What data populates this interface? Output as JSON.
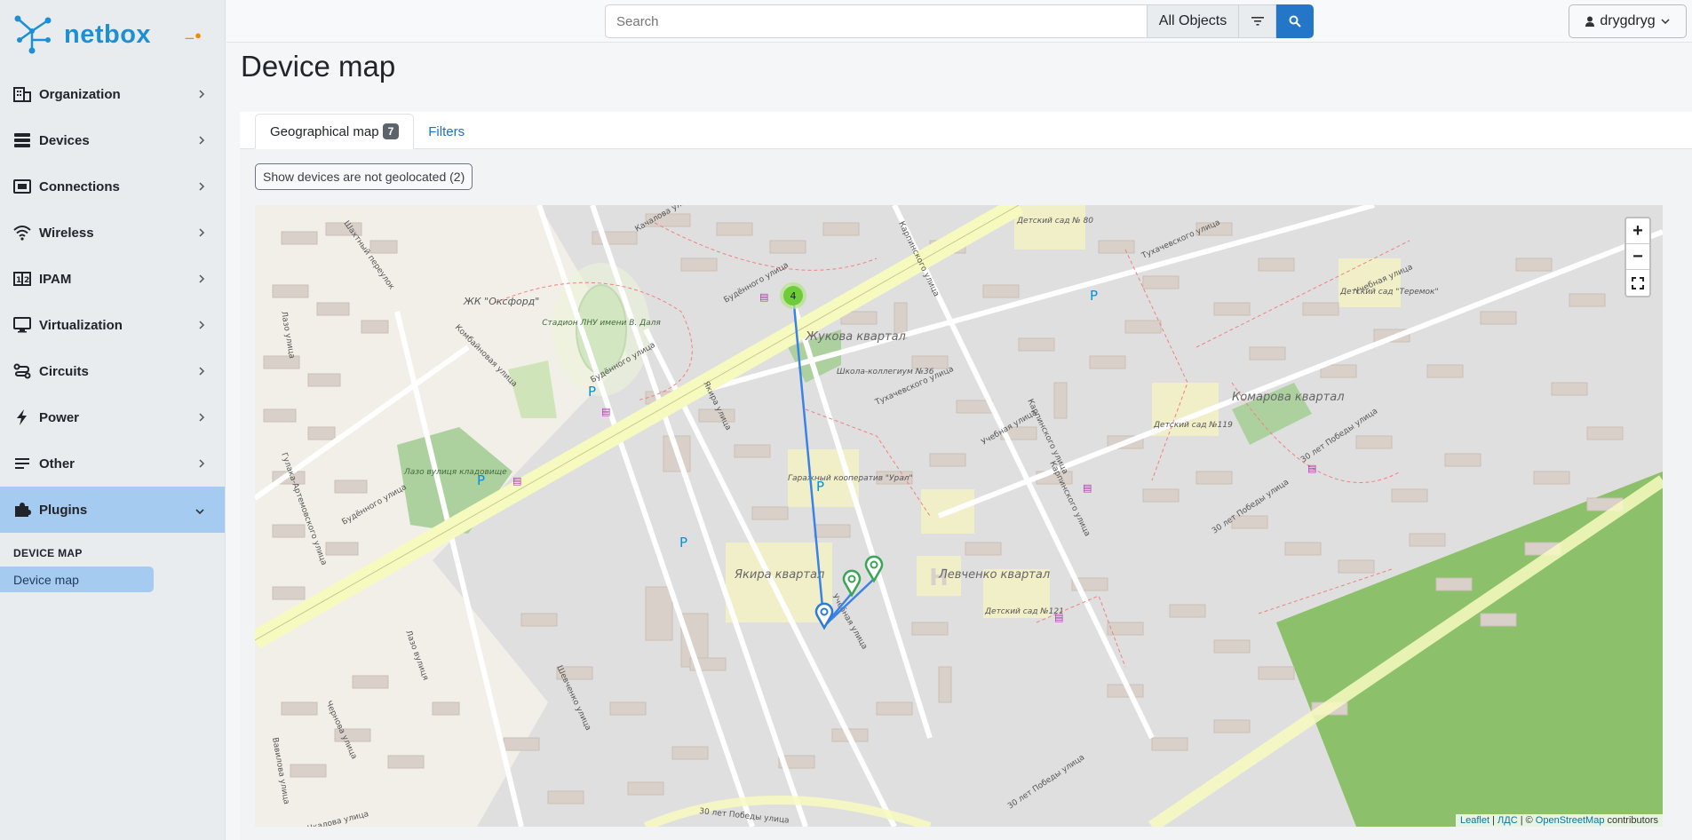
{
  "brand": {
    "name": "netbox"
  },
  "sidebar": {
    "items": [
      {
        "label": "Organization",
        "icon": "building-icon"
      },
      {
        "label": "Devices",
        "icon": "server-icon"
      },
      {
        "label": "Connections",
        "icon": "ethernet-icon"
      },
      {
        "label": "Wireless",
        "icon": "wifi-icon"
      },
      {
        "label": "IPAM",
        "icon": "counter-icon"
      },
      {
        "label": "Virtualization",
        "icon": "monitor-icon"
      },
      {
        "label": "Circuits",
        "icon": "transit-icon"
      },
      {
        "label": "Power",
        "icon": "lightning-icon"
      },
      {
        "label": "Other",
        "icon": "notes-icon"
      },
      {
        "label": "Plugins",
        "icon": "puzzle-icon"
      }
    ],
    "plugin_section": "DEVICE MAP",
    "plugin_item": "Device map"
  },
  "topbar": {
    "search_placeholder": "Search",
    "scope": "All Objects",
    "user": "drygdryg"
  },
  "page": {
    "title": "Device map",
    "tab_map": "Geographical map",
    "tab_map_count": "7",
    "tab_filters": "Filters",
    "not_geolocated_button": "Show devices are not geolocated (2)"
  },
  "map": {
    "cluster_count": "4",
    "labels": {
      "zhukova": "Жукова квартал",
      "yakira": "Якира квартал",
      "levchenko": "Левченко квартал",
      "komarova": "Комарова квартал",
      "oxford": "ЖК \"Оксфорд\"",
      "stadium": "Стадион ЛНУ имени В. Даля",
      "cemetery": "Лазо вулиця кладовище",
      "school": "Школа-коллегиум №36",
      "garage": "Гаражный кооператив \"Урал\"",
      "kg80": "Детский сад № 80",
      "kg119": "Детский сад №119",
      "kg121": "Детский сад №121",
      "teremok": "Детский сад \"Теремок\"",
      "street_budennogo": "Будённого улица",
      "street_tukhachevskogo": "Тухачевского улица",
      "street_uchebnaya": "Учебная улица",
      "street_karpinskogo": "Карпинского улица",
      "street_yakira": "Якира улица",
      "street_30let": "30 лет Победы улица",
      "street_lazo": "Лазо улица",
      "street_kombainovaya": "Комбайновая улица",
      "street_chkalova": "Чкалова улица",
      "street_kachalova": "Качалова улица",
      "street_shakhtny": "Шахтный переулок",
      "street_gulaka": "Гулака-Артемовского улица",
      "street_chernova": "Чернова улица",
      "street_shevchenko": "Шевченко улица",
      "street_vavilova": "Вавилова улица",
      "street_lazo_ua": "Лазо вулиця"
    },
    "attribution_leaflet": "Leaflet",
    "attribution_lds": "ЛДС",
    "attribution_osm": "OpenStreetMap",
    "attribution_suffix": "contributors",
    "colors": {
      "park": "#add19e",
      "road": "#f7fabf",
      "building": "#d9d0c9",
      "residential": "#e0dfdf",
      "line": "#3b82e6"
    }
  },
  "zoom": {
    "in": "+",
    "out": "−"
  }
}
